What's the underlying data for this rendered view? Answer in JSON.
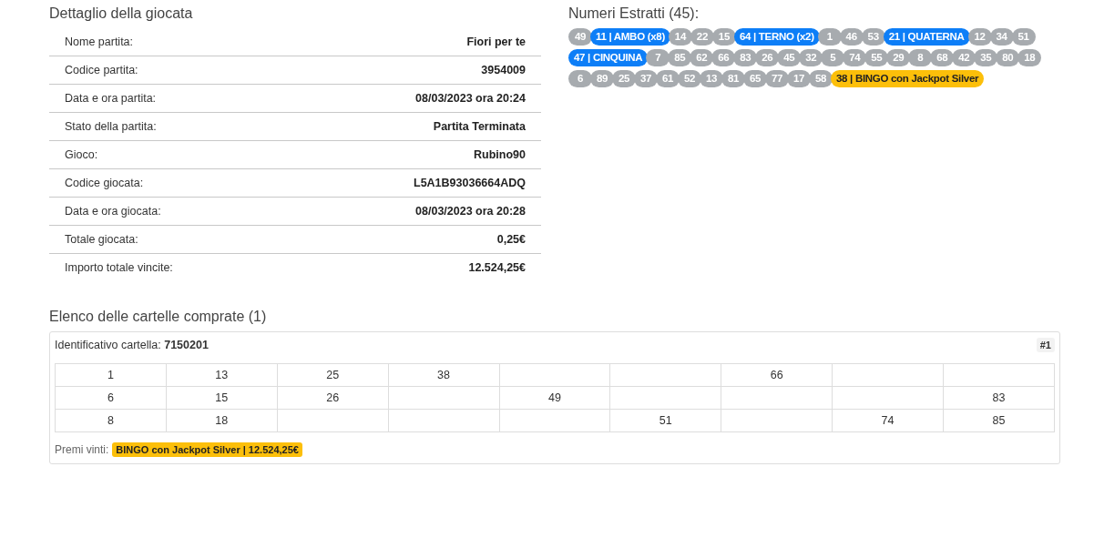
{
  "details": {
    "title": "Dettaglio della giocata",
    "rows": [
      {
        "label": "Nome partita:",
        "value": "Fiori per te"
      },
      {
        "label": "Codice partita:",
        "value": "3954009"
      },
      {
        "label": "Data e ora partita:",
        "value": "08/03/2023 ora 20:24"
      },
      {
        "label": "Stato della partita:",
        "value": "Partita Terminata"
      },
      {
        "label": "Gioco:",
        "value": "Rubino90"
      },
      {
        "label": "Codice giocata:",
        "value": "L5A1B93036664ADQ"
      },
      {
        "label": "Data e ora giocata:",
        "value": "08/03/2023 ora 20:28"
      },
      {
        "label": "Totale giocata:",
        "value": "0,25€"
      },
      {
        "label": "Importo totale vincite:",
        "value": "12.524,25€"
      }
    ]
  },
  "drawn": {
    "title": "Numeri Estratti (45):",
    "balls": [
      {
        "label": "49",
        "kind": "plain"
      },
      {
        "label": "11 | AMBO (x8)",
        "kind": "prize"
      },
      {
        "label": "14",
        "kind": "plain"
      },
      {
        "label": "22",
        "kind": "plain"
      },
      {
        "label": "15",
        "kind": "plain"
      },
      {
        "label": "64 | TERNO (x2)",
        "kind": "prize"
      },
      {
        "label": "1",
        "kind": "plain"
      },
      {
        "label": "46",
        "kind": "plain"
      },
      {
        "label": "53",
        "kind": "plain"
      },
      {
        "label": "21 | QUATERNA",
        "kind": "prize"
      },
      {
        "label": "12",
        "kind": "plain"
      },
      {
        "label": "34",
        "kind": "plain"
      },
      {
        "label": "51",
        "kind": "plain"
      },
      {
        "label": "47 | CINQUINA",
        "kind": "prize"
      },
      {
        "label": "7",
        "kind": "plain"
      },
      {
        "label": "85",
        "kind": "plain"
      },
      {
        "label": "62",
        "kind": "plain"
      },
      {
        "label": "66",
        "kind": "plain"
      },
      {
        "label": "83",
        "kind": "plain"
      },
      {
        "label": "26",
        "kind": "plain"
      },
      {
        "label": "45",
        "kind": "plain"
      },
      {
        "label": "32",
        "kind": "plain"
      },
      {
        "label": "5",
        "kind": "plain"
      },
      {
        "label": "74",
        "kind": "plain"
      },
      {
        "label": "55",
        "kind": "plain"
      },
      {
        "label": "29",
        "kind": "plain"
      },
      {
        "label": "8",
        "kind": "plain"
      },
      {
        "label": "68",
        "kind": "plain"
      },
      {
        "label": "42",
        "kind": "plain"
      },
      {
        "label": "35",
        "kind": "plain"
      },
      {
        "label": "80",
        "kind": "plain"
      },
      {
        "label": "18",
        "kind": "plain"
      },
      {
        "label": "6",
        "kind": "plain"
      },
      {
        "label": "89",
        "kind": "plain"
      },
      {
        "label": "25",
        "kind": "plain"
      },
      {
        "label": "37",
        "kind": "plain"
      },
      {
        "label": "61",
        "kind": "plain"
      },
      {
        "label": "52",
        "kind": "plain"
      },
      {
        "label": "13",
        "kind": "plain"
      },
      {
        "label": "81",
        "kind": "plain"
      },
      {
        "label": "65",
        "kind": "plain"
      },
      {
        "label": "77",
        "kind": "plain"
      },
      {
        "label": "17",
        "kind": "plain"
      },
      {
        "label": "58",
        "kind": "plain"
      },
      {
        "label": "38 | BINGO con Jackpot Silver",
        "kind": "jackpot"
      }
    ]
  },
  "cards": {
    "title": "Elenco delle cartelle comprate (1)",
    "items": [
      {
        "id_text": "Identificativo cartella: **7150201**",
        "index": "#1",
        "grid": [
          [
            {
              "value": "1"
            },
            {
              "value": "13"
            },
            {
              "value": "25"
            },
            {
              "value": "38"
            },
            {
              "empty": true
            },
            {
              "empty": true
            },
            {
              "value": "66"
            },
            {
              "empty": true
            },
            {
              "empty": true
            }
          ],
          [
            {
              "value": "6"
            },
            {
              "value": "15"
            },
            {
              "value": "26"
            },
            {
              "empty": true
            },
            {
              "value": "49"
            },
            {
              "empty": true
            },
            {
              "empty": true
            },
            {
              "empty": true
            },
            {
              "value": "83"
            }
          ],
          [
            {
              "value": "8"
            },
            {
              "value": "18"
            },
            {
              "empty": true
            },
            {
              "empty": true
            },
            {
              "empty": true
            },
            {
              "value": "51"
            },
            {
              "empty": true
            },
            {
              "value": "74"
            },
            {
              "value": "85"
            }
          ]
        ],
        "prizes_label": "Premi vinti:",
        "prizes": [
          "BINGO con Jackpot Silver | 12.524,25€"
        ]
      }
    ]
  }
}
